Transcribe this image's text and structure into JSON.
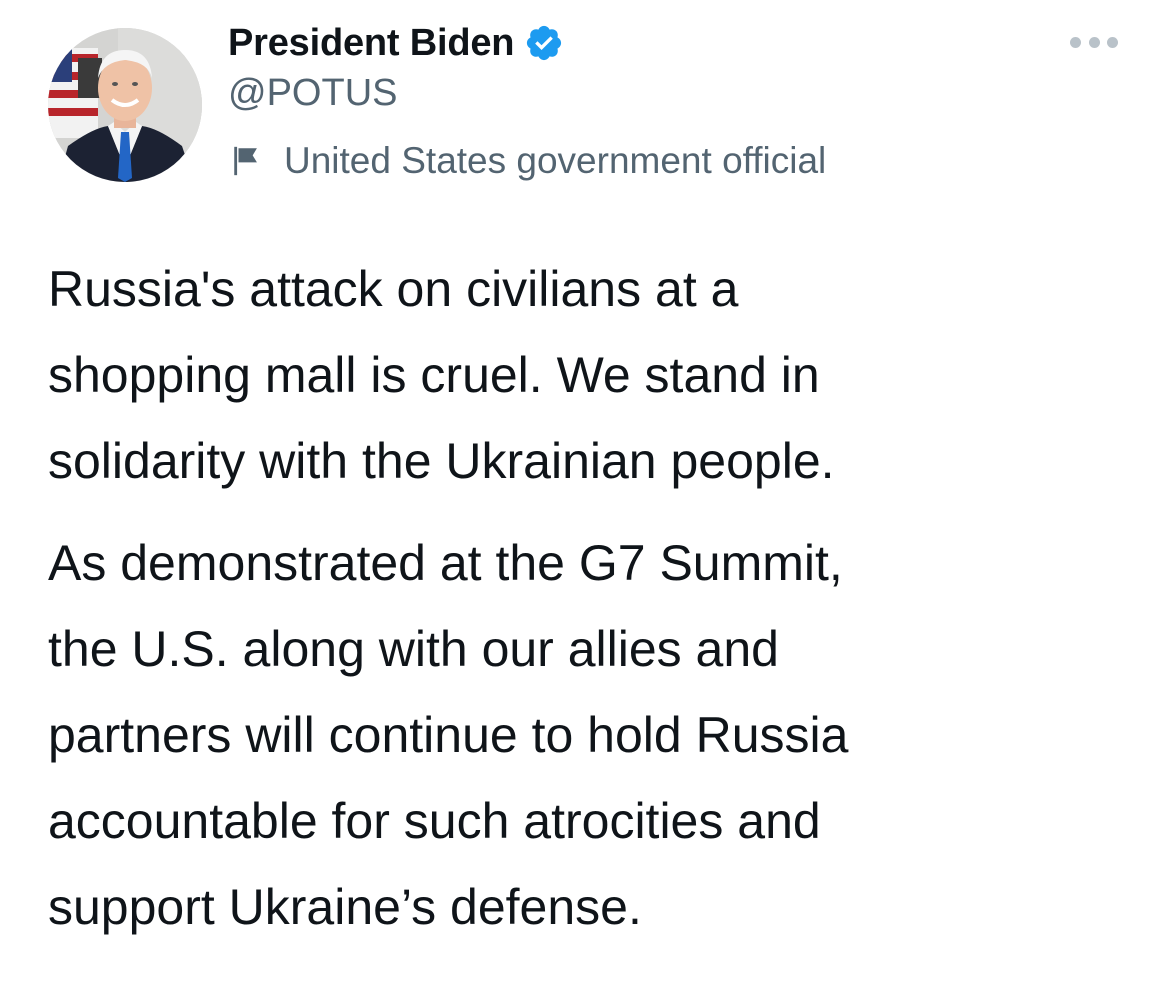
{
  "author": {
    "name": "President Biden",
    "handle": "@POTUS",
    "verified": true,
    "label": "United States government official",
    "avatar_icon": "portrait-photo"
  },
  "menu": {
    "icon": "more-horizontal-icon"
  },
  "tweet": {
    "paragraphs": [
      "Russia's attack on civilians at a\nshopping mall is cruel. We stand in\nsolidarity with the Ukrainian people.",
      "As demonstrated at the G7 Summit,\nthe U.S. along with our allies and\npartners will continue to hold Russia\naccountable for such atrocities and\nsupport Ukraine’s defense."
    ]
  },
  "colors": {
    "text_primary": "#0f1419",
    "text_secondary": "#536471",
    "verified_blue": "#1d9bf0",
    "menu_dots": "#b9c2c9"
  }
}
